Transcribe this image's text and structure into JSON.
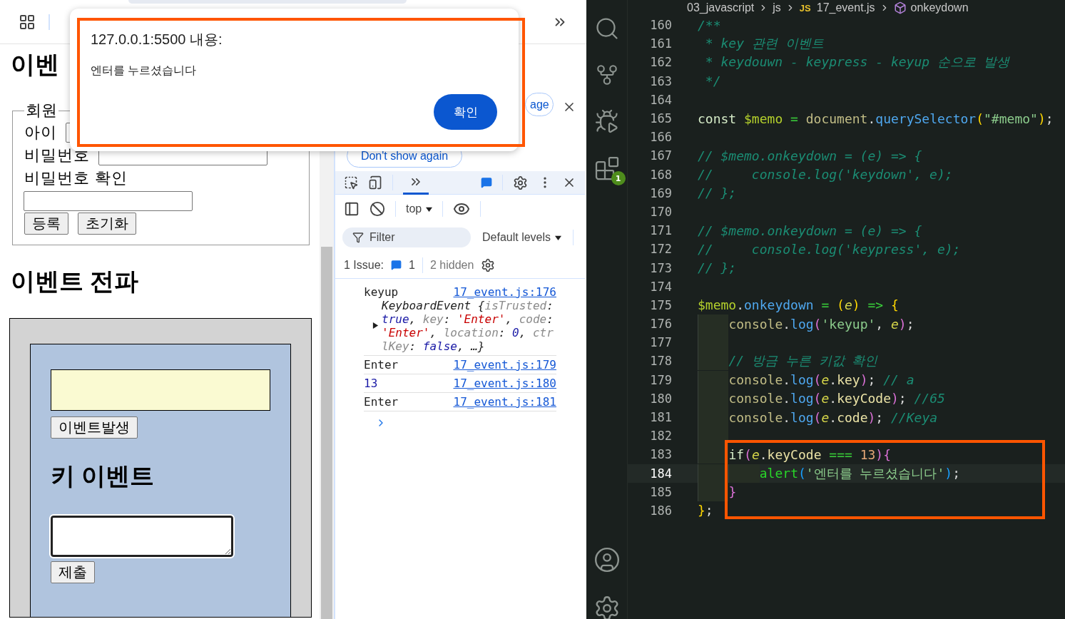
{
  "page": {
    "heading": "이벤",
    "signup": {
      "legend": "회원",
      "id_label": "아이",
      "password_label": "비밀번호",
      "confirm_label": "비밀번호 확인",
      "buttons": [
        "등록",
        "초기화"
      ]
    },
    "propagation_heading": "이벤트 전파",
    "event_button": "이벤트발생",
    "key_heading": "키 이벤트",
    "submit_button": "제출"
  },
  "alert": {
    "title": "127.0.0.1:5500 내용:",
    "message": "엔터를 누르셨습니다",
    "ok_button": "확인"
  },
  "devtools": {
    "banner_button": "age",
    "dismiss_button": "Don't show again",
    "context": "top",
    "filter_placeholder": "Filter",
    "levels": "Default levels",
    "issues": {
      "label": "1 Issue:",
      "count": "1",
      "hidden": "2 hidden"
    },
    "messages": [
      {
        "kind": "object",
        "text": "keyup",
        "source": "17_event.js:176",
        "expanded": false,
        "detail": [
          {
            "kind": "plain",
            "text": "KeyboardEvent {"
          },
          {
            "kind": "key",
            "text": "isTrusted"
          },
          {
            "kind": "plain",
            "text": ": "
          },
          {
            "kind": "keyword",
            "text": "true"
          },
          {
            "kind": "plain",
            "text": ", "
          },
          {
            "kind": "key",
            "text": "key"
          },
          {
            "kind": "plain",
            "text": ": "
          },
          {
            "kind": "string",
            "text": "'Enter'"
          },
          {
            "kind": "plain",
            "text": ", "
          },
          {
            "kind": "key",
            "text": "code"
          },
          {
            "kind": "plain",
            "text": ": "
          },
          {
            "kind": "string",
            "text": "'Enter'"
          },
          {
            "kind": "plain",
            "text": ", "
          },
          {
            "kind": "key",
            "text": "location"
          },
          {
            "kind": "plain",
            "text": ": "
          },
          {
            "kind": "number",
            "text": "0"
          },
          {
            "kind": "plain",
            "text": ", "
          },
          {
            "kind": "key",
            "text": "ctrlKey"
          },
          {
            "kind": "plain",
            "text": ": "
          },
          {
            "kind": "keyword",
            "text": "false"
          },
          {
            "kind": "plain",
            "text": ", …}"
          }
        ]
      },
      {
        "kind": "string",
        "text": "Enter",
        "source": "17_event.js:179"
      },
      {
        "kind": "number",
        "text": "13",
        "source": "17_event.js:180"
      },
      {
        "kind": "string",
        "text": "Enter",
        "source": "17_event.js:181"
      }
    ]
  },
  "editor": {
    "breadcrumb": [
      {
        "kind": "folder",
        "text": "03_javascript"
      },
      {
        "kind": "folder",
        "text": "js"
      },
      {
        "kind": "file",
        "icon_text": "JS",
        "text": "17_event.js"
      },
      {
        "kind": "symbol",
        "text": "onkeydown"
      }
    ],
    "extensions_badge": "1",
    "lines": [
      {
        "number": "160",
        "current": false,
        "tokens": [
          {
            "kind": "comment",
            "text": "/**"
          }
        ]
      },
      {
        "number": "161",
        "current": false,
        "tokens": [
          {
            "kind": "comment",
            "text": " * key 관련 이벤트"
          }
        ]
      },
      {
        "number": "162",
        "current": false,
        "tokens": [
          {
            "kind": "comment",
            "text": " * keydouwn - keypress - keyup 순으로 발생"
          }
        ]
      },
      {
        "number": "163",
        "current": false,
        "tokens": [
          {
            "kind": "comment",
            "text": " */"
          }
        ]
      },
      {
        "number": "164",
        "current": false
      },
      {
        "number": "165",
        "current": false,
        "tokens": [
          {
            "kind": "keyword",
            "text": "const "
          },
          {
            "kind": "variable",
            "text": "$memo "
          },
          {
            "kind": "operator",
            "text": "= "
          },
          {
            "kind": "object",
            "text": "document"
          },
          {
            "kind": "punct",
            "text": "."
          },
          {
            "kind": "method",
            "text": "querySelector"
          },
          {
            "kind": "bracket1",
            "text": "("
          },
          {
            "kind": "string",
            "text": "\"#memo\""
          },
          {
            "kind": "bracket1",
            "text": ")"
          },
          {
            "kind": "punct",
            "text": ";"
          }
        ]
      },
      {
        "number": "166",
        "current": false
      },
      {
        "number": "167",
        "current": false,
        "tokens": [
          {
            "kind": "comment",
            "text": "// $memo.onkeydown = (e) => {"
          }
        ]
      },
      {
        "number": "168",
        "current": false,
        "tokens": [
          {
            "kind": "comment",
            "text": "//     console.log('keydown', e);"
          }
        ]
      },
      {
        "number": "169",
        "current": false,
        "tokens": [
          {
            "kind": "comment",
            "text": "// };"
          }
        ]
      },
      {
        "number": "170",
        "current": false
      },
      {
        "number": "171",
        "current": false,
        "tokens": [
          {
            "kind": "comment",
            "text": "// $memo.onkeydown = (e) => {"
          }
        ]
      },
      {
        "number": "172",
        "current": false,
        "tokens": [
          {
            "kind": "comment",
            "text": "//     console.log('keypress', e);"
          }
        ]
      },
      {
        "number": "173",
        "current": false,
        "tokens": [
          {
            "kind": "comment",
            "text": "// };"
          }
        ]
      },
      {
        "number": "174",
        "current": false
      },
      {
        "number": "175",
        "current": false,
        "tokens": [
          {
            "kind": "variable",
            "text": "$memo"
          },
          {
            "kind": "punct",
            "text": "."
          },
          {
            "kind": "method",
            "text": "onkeydown"
          },
          {
            "kind": "operator",
            "text": " = "
          },
          {
            "kind": "bracket1",
            "text": "("
          },
          {
            "kind": "param",
            "text": "e"
          },
          {
            "kind": "bracket1",
            "text": ")"
          },
          {
            "kind": "operator",
            "text": " => "
          },
          {
            "kind": "bracket1",
            "text": "{"
          }
        ],
        "children": [
          {
            "number": "176",
            "current": false,
            "tokens": [
              {
                "kind": "object",
                "text": "console"
              },
              {
                "kind": "punct",
                "text": "."
              },
              {
                "kind": "method",
                "text": "log"
              },
              {
                "kind": "bracket2",
                "text": "("
              },
              {
                "kind": "string",
                "text": "'keyup'"
              },
              {
                "kind": "punct",
                "text": ", "
              },
              {
                "kind": "param",
                "text": "e"
              },
              {
                "kind": "bracket2",
                "text": ")"
              },
              {
                "kind": "punct",
                "text": ";"
              }
            ]
          },
          {
            "number": "177",
            "current": false
          },
          {
            "number": "178",
            "current": false,
            "tokens": [
              {
                "kind": "comment",
                "text": "// 방금 누른 키값 확인"
              }
            ]
          },
          {
            "number": "179",
            "current": false,
            "tokens": [
              {
                "kind": "object",
                "text": "console"
              },
              {
                "kind": "punct",
                "text": "."
              },
              {
                "kind": "method",
                "text": "log"
              },
              {
                "kind": "bracket2",
                "text": "("
              },
              {
                "kind": "param",
                "text": "e"
              },
              {
                "kind": "punct",
                "text": "."
              },
              {
                "kind": "property",
                "text": "key"
              },
              {
                "kind": "bracket2",
                "text": ")"
              },
              {
                "kind": "punct",
                "text": "; "
              },
              {
                "kind": "comment",
                "text": "// a"
              }
            ]
          },
          {
            "number": "180",
            "current": false,
            "tokens": [
              {
                "kind": "object",
                "text": "console"
              },
              {
                "kind": "punct",
                "text": "."
              },
              {
                "kind": "method",
                "text": "log"
              },
              {
                "kind": "bracket2",
                "text": "("
              },
              {
                "kind": "param",
                "text": "e"
              },
              {
                "kind": "punct",
                "text": "."
              },
              {
                "kind": "property",
                "text": "keyCode"
              },
              {
                "kind": "bracket2",
                "text": ")"
              },
              {
                "kind": "punct",
                "text": "; "
              },
              {
                "kind": "comment",
                "text": "//65"
              }
            ]
          },
          {
            "number": "181",
            "current": false,
            "tokens": [
              {
                "kind": "object",
                "text": "console"
              },
              {
                "kind": "punct",
                "text": "."
              },
              {
                "kind": "method",
                "text": "log"
              },
              {
                "kind": "bracket2",
                "text": "("
              },
              {
                "kind": "param",
                "text": "e"
              },
              {
                "kind": "punct",
                "text": "."
              },
              {
                "kind": "property",
                "text": "code"
              },
              {
                "kind": "bracket2",
                "text": ")"
              },
              {
                "kind": "punct",
                "text": "; "
              },
              {
                "kind": "comment",
                "text": "//Keya"
              }
            ]
          },
          {
            "number": "182",
            "current": false
          },
          {
            "number": "183",
            "current": false,
            "tokens": [
              {
                "kind": "keyword",
                "text": "if"
              },
              {
                "kind": "bracket2",
                "text": "("
              },
              {
                "kind": "param",
                "text": "e"
              },
              {
                "kind": "punct",
                "text": "."
              },
              {
                "kind": "property",
                "text": "keyCode"
              },
              {
                "kind": "operator",
                "text": " === "
              },
              {
                "kind": "number",
                "text": "13"
              },
              {
                "kind": "bracket2",
                "text": ")"
              },
              {
                "kind": "bracket2",
                "text": "{"
              }
            ],
            "children": [
              {
                "number": "184",
                "current": true,
                "tokens": [
                  {
                    "kind": "func",
                    "text": "alert"
                  },
                  {
                    "kind": "bracket3",
                    "text": "("
                  },
                  {
                    "kind": "string",
                    "text": "'엔터를 누르셨습니다'"
                  },
                  {
                    "kind": "bracket3",
                    "text": ")"
                  },
                  {
                    "kind": "punct",
                    "text": ";"
                  }
                ]
              }
            ]
          },
          {
            "number": "185",
            "current": false,
            "tokens": [
              {
                "kind": "bracket2",
                "text": "}"
              }
            ]
          }
        ]
      },
      {
        "number": "186",
        "current": false,
        "tokens": [
          {
            "kind": "bracket1",
            "text": "}"
          },
          {
            "kind": "punct",
            "text": ";"
          }
        ]
      }
    ]
  }
}
